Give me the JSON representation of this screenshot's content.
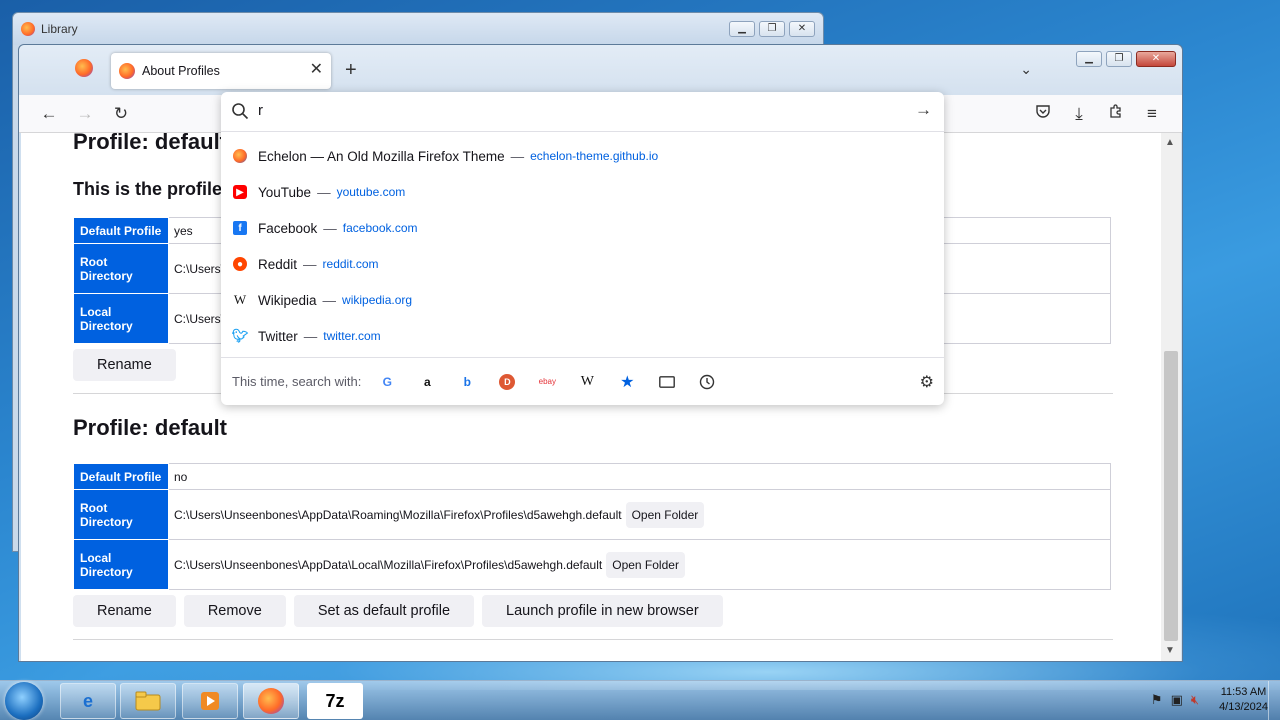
{
  "library_window": {
    "title": "Library"
  },
  "firefox": {
    "tab": {
      "label": "About Profiles"
    },
    "urlbar": {
      "typed": "r",
      "results": [
        {
          "title": "Echelon — An Old Mozilla Firefox Theme",
          "url": "echelon-theme.github.io",
          "icon": "echelon-icon"
        },
        {
          "title": "YouTube",
          "url": "youtube.com",
          "icon": "youtube-icon"
        },
        {
          "title": "Facebook",
          "url": "facebook.com",
          "icon": "facebook-icon"
        },
        {
          "title": "Reddit",
          "url": "reddit.com",
          "icon": "reddit-icon"
        },
        {
          "title": "Wikipedia",
          "url": "wikipedia.org",
          "icon": "wikipedia-icon"
        },
        {
          "title": "Twitter",
          "url": "twitter.com",
          "icon": "twitter-icon"
        }
      ],
      "separator": "—",
      "search_with_label": "This time, search with:",
      "engines": [
        "google-icon",
        "amazon-icon",
        "bing-icon",
        "duckduckgo-icon",
        "ebay-icon",
        "wikipedia-icon",
        "bookmarks-icon",
        "tabs-icon",
        "history-icon"
      ]
    },
    "profiles": [
      {
        "title": "Profile: default",
        "subtitle": "This is the profile",
        "labels": {
          "default": "Default Profile",
          "root": "Root Directory",
          "local": "Local Directory"
        },
        "default_value": "yes",
        "root_value": "C:\\Users\\",
        "local_value": "C:\\Users\\",
        "buttons": {
          "rename": "Rename"
        }
      },
      {
        "title": "Profile: default",
        "labels": {
          "default": "Default Profile",
          "root": "Root Directory",
          "local": "Local Directory"
        },
        "default_value": "no",
        "root_value": "C:\\Users\\Unseenbones\\AppData\\Roaming\\Mozilla\\Firefox\\Profiles\\d5awehgh.default",
        "local_value": "C:\\Users\\Unseenbones\\AppData\\Local\\Mozilla\\Firefox\\Profiles\\d5awehgh.default",
        "open_folder": "Open Folder",
        "buttons": {
          "rename": "Rename",
          "remove": "Remove",
          "set_default": "Set as default profile",
          "launch": "Launch profile in new browser"
        }
      }
    ]
  },
  "taskbar": {
    "time": "11:53 AM",
    "date": "4/13/2024",
    "7zip_label": "7z"
  },
  "colors": {
    "accent": "#0061e0",
    "table_header": "#0061e0"
  }
}
